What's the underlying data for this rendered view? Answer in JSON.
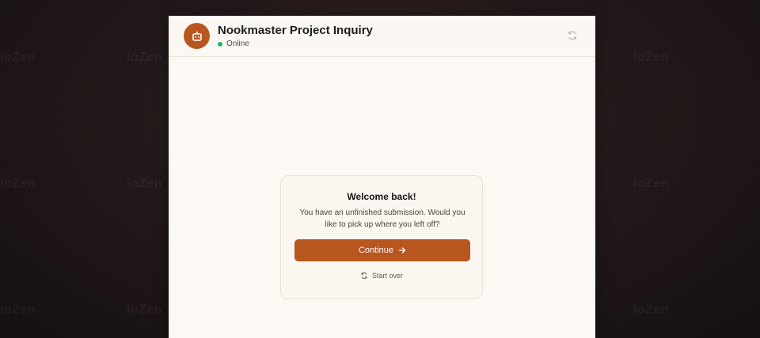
{
  "watermark": {
    "text": "IoZen"
  },
  "header": {
    "avatar_icon": "bot-icon",
    "title": "Nookmaster Project Inquiry",
    "status": "Online",
    "refresh_icon": "refresh-icon"
  },
  "resume_card": {
    "title": "Welcome back!",
    "message": "You have an unfinished submission. Would you like to pick up where you left off?",
    "continue_label": "Continue",
    "continue_icon": "arrow-right-icon",
    "start_over_label": "Start over",
    "start_over_icon": "refresh-icon"
  },
  "colors": {
    "accent": "#b8561f",
    "status": "#20b46c",
    "panel_background": "#fcf9f5",
    "card_background": "#fbf6f0"
  }
}
